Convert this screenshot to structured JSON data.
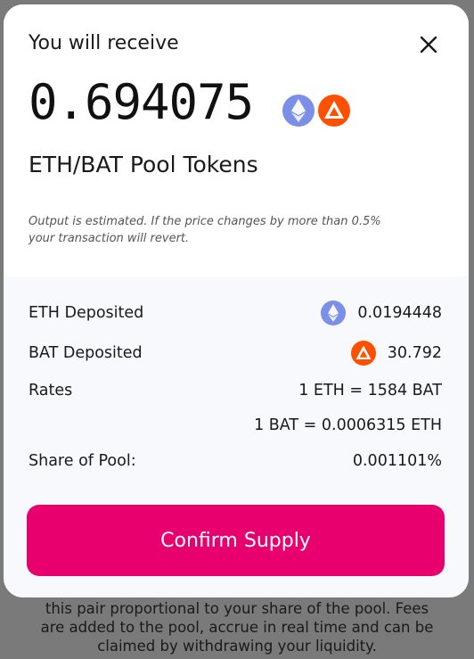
{
  "backdrop": {
    "lines": [
      "this pair proportional to your share of the pool. Fees",
      "are added to the pool, accrue in real time and can be",
      "claimed by withdrawing your liquidity."
    ]
  },
  "modal": {
    "title": "You will receive",
    "amount": "0.694075",
    "pool_label": "ETH/BAT Pool Tokens",
    "note_line1": "Output is estimated. If the price changes by more than 0.5%",
    "note_line2": "your transaction will revert.",
    "icons": {
      "close": "close-icon",
      "token_a": "eth-icon",
      "token_b": "bat-icon"
    }
  },
  "details": {
    "eth_deposited_label": "ETH Deposited",
    "eth_deposited_value": "0.0194448",
    "bat_deposited_label": "BAT Deposited",
    "bat_deposited_value": "30.792",
    "rates_label": "Rates",
    "rate_1": "1 ETH = 1584 BAT",
    "rate_2": "1 BAT = 0.0006315 ETH",
    "share_label": "Share of Pool:",
    "share_value": "0.001101%"
  },
  "confirm_label": "Confirm Supply",
  "colors": {
    "accent": "#e8006f",
    "eth": "#7b8ee8",
    "bat": "#ff5000"
  }
}
